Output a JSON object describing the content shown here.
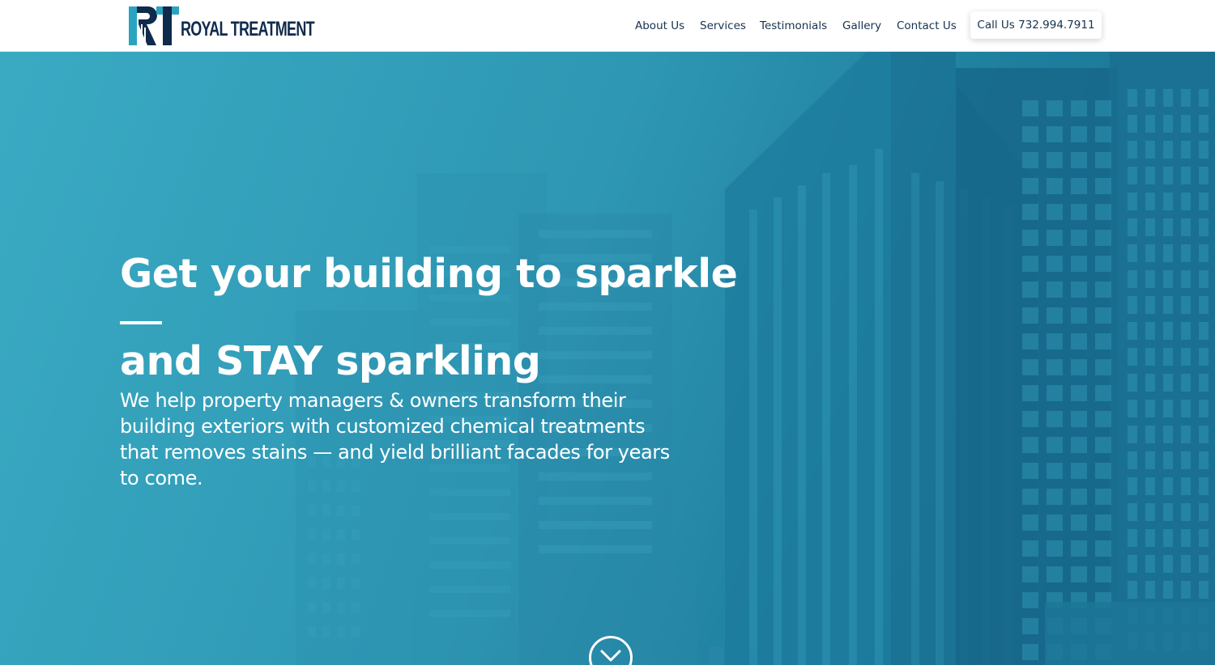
{
  "brand": {
    "logo_mark": "RT",
    "name": "ROYAL TREATMENT",
    "colors": {
      "navy": "#0f2b4c",
      "teal": "#2aa3c0",
      "hero_dark": "#186f93"
    }
  },
  "nav": {
    "items": [
      {
        "label": "About Us"
      },
      {
        "label": "Services"
      },
      {
        "label": "Testimonials"
      },
      {
        "label": "Gallery"
      },
      {
        "label": "Contact Us"
      }
    ],
    "cta_label": "Call Us 732.994.7911"
  },
  "hero": {
    "title_line1": "Get your building to sparkle",
    "title_line2": "and STAY sparkling",
    "body": "We help property managers & owners transform their building exteriors with customized chemical treatments that removes stains — and yield brilliant facades for years to come.",
    "scroll_icon": "chevron-down-circle-icon"
  }
}
